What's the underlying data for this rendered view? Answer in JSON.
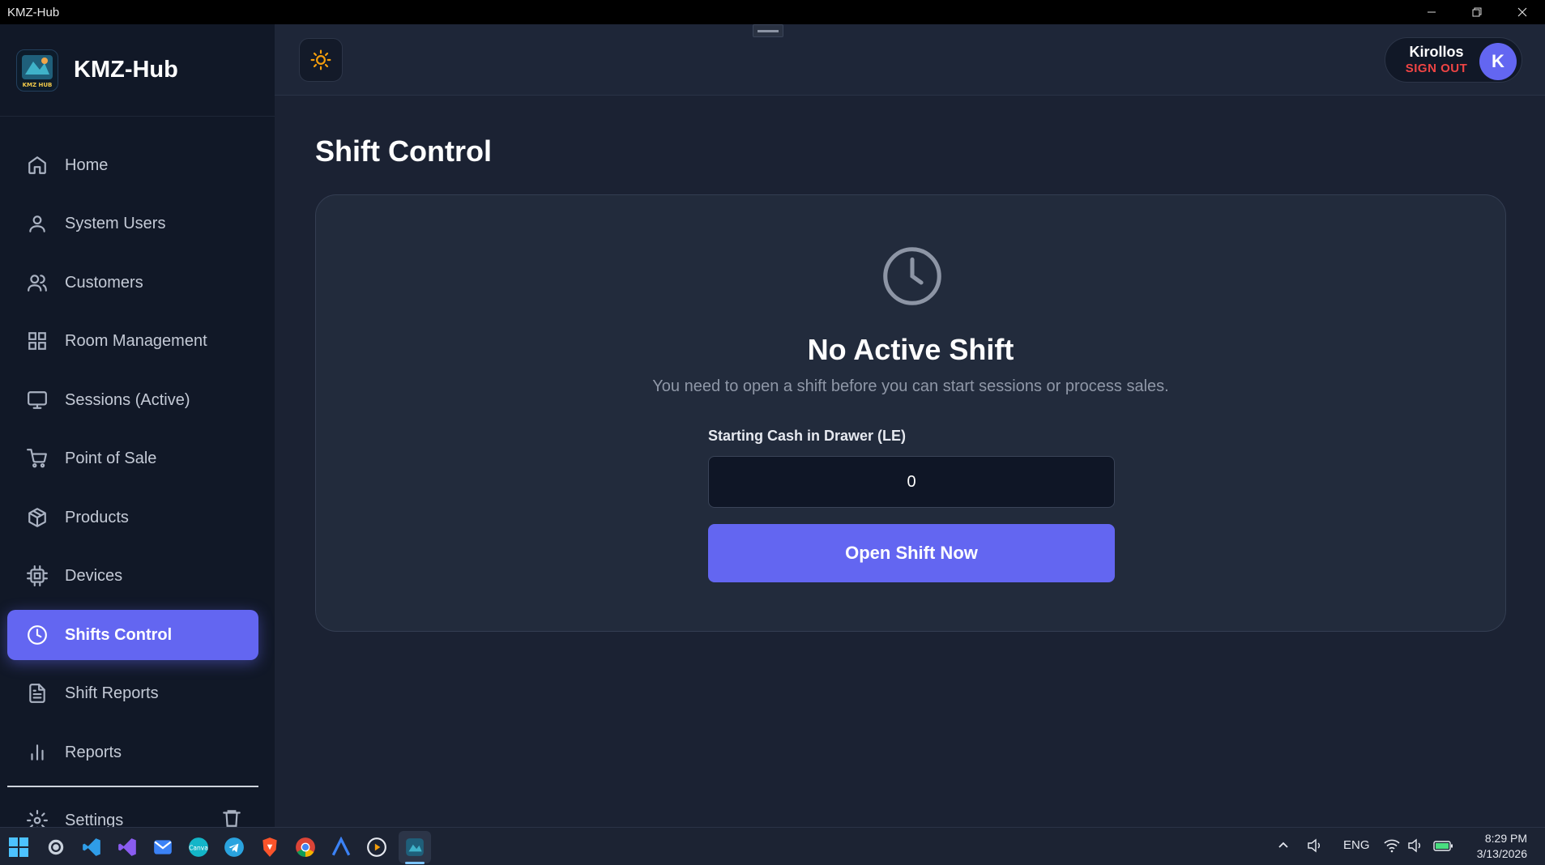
{
  "window": {
    "title": "KMZ-Hub",
    "controls": [
      "minimize-icon",
      "restore-icon",
      "close-icon"
    ]
  },
  "sidebar": {
    "brand": "KMZ-Hub",
    "logo_text": "KMZ HUB",
    "items": [
      {
        "label": "Home",
        "icon": "home-icon"
      },
      {
        "label": "System Users",
        "icon": "user-icon"
      },
      {
        "label": "Customers",
        "icon": "users-icon"
      },
      {
        "label": "Room Management",
        "icon": "grid-icon"
      },
      {
        "label": "Sessions (Active)",
        "icon": "monitor-icon"
      },
      {
        "label": "Point of Sale",
        "icon": "cart-icon"
      },
      {
        "label": "Products",
        "icon": "package-icon"
      },
      {
        "label": "Devices",
        "icon": "cpu-icon"
      },
      {
        "label": "Shifts Control",
        "icon": "clock-icon",
        "active": true
      },
      {
        "label": "Shift Reports",
        "icon": "file-text-icon"
      },
      {
        "label": "Reports",
        "icon": "bar-chart-icon"
      },
      {
        "label": "Settings",
        "icon": "gear-icon"
      }
    ]
  },
  "header": {
    "theme_toggle_icon": "sun-icon",
    "user": {
      "name": "Kirollos",
      "sign_out": "SIGN OUT",
      "avatar_initial": "K"
    }
  },
  "main": {
    "page_title": "Shift Control",
    "empty_state": {
      "icon": "clock-icon",
      "title": "No Active Shift",
      "subtitle": "You need to open a shift before you can start sessions or process sales."
    },
    "starting_cash": {
      "label": "Starting Cash in Drawer (LE)",
      "value": "0"
    },
    "open_button": "Open Shift Now"
  },
  "taskbar": {
    "apps": [
      "windows-start-icon",
      "settings-app-icon",
      "vscode-icon",
      "visual-studio-icon",
      "mail-app-icon",
      "canva-icon",
      "telegram-icon",
      "brave-icon",
      "chrome-icon",
      "a-app-icon",
      "media-player-icon",
      "kmz-hub-app-icon"
    ],
    "language": "ENG",
    "time": "8:29 PM",
    "date": "3/13/2026"
  },
  "colors": {
    "accent": "#6366f1",
    "danger": "#ef4444",
    "theme_icon": "#f59e0b"
  }
}
